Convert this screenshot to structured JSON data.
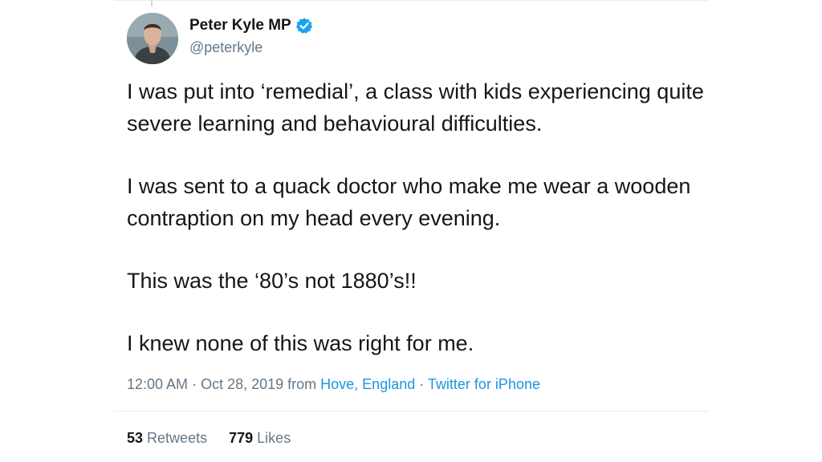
{
  "author": {
    "display_name": "Peter Kyle MP",
    "handle": "@peterkyle",
    "verified": true,
    "verified_icon": "verified-badge-icon"
  },
  "tweet": {
    "paragraphs": [
      "I was put into ‘remedial’, a class with kids experiencing quite severe learning and behavioural difficulties.",
      "I was sent to a quack doctor who make me wear a wooden contraption on my head every evening.",
      "This was the ‘80’s not 1880’s!!",
      "I knew none of this was right for me."
    ]
  },
  "meta": {
    "time": "12:00 AM",
    "sep1": " · ",
    "date": "Oct 28, 2019",
    "from": " from ",
    "location": "Hove, England",
    "sep2": " · ",
    "source": "Twitter for iPhone"
  },
  "stats": {
    "retweets_count": "53",
    "retweets_label": "Retweets",
    "likes_count": "779",
    "likes_label": "Likes"
  },
  "colors": {
    "text": "#14171a",
    "secondary": "#657786",
    "link": "#1b95e0",
    "verified": "#1da1f2",
    "divider": "#e6ecf0"
  }
}
